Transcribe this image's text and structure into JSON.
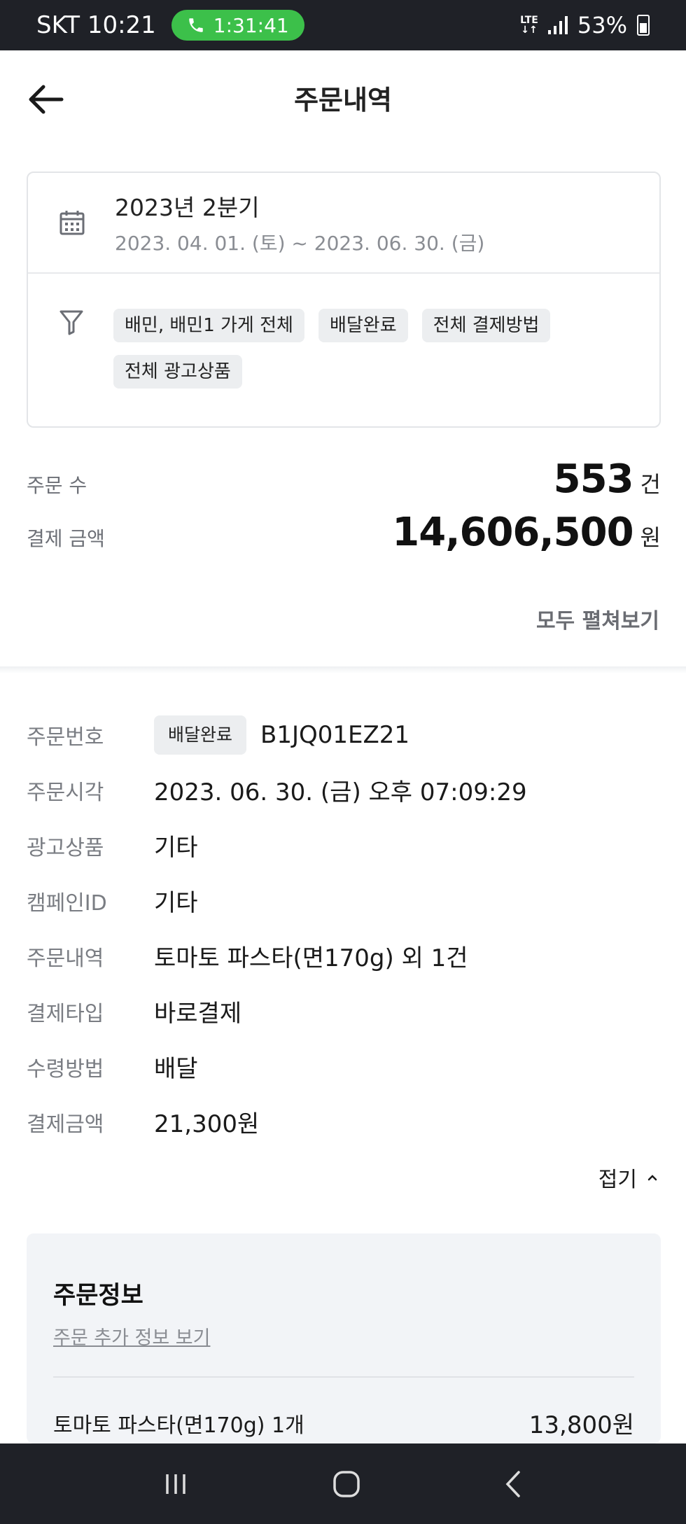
{
  "status_bar": {
    "carrier_time": "SKT 10:21",
    "call_timer": "1:31:41",
    "network": "LTE",
    "battery": "53%"
  },
  "header": {
    "title": "주문내역"
  },
  "period": {
    "title": "2023년 2분기",
    "range": "2023. 04. 01. (토) ~ 2023. 06. 30. (금)"
  },
  "filters": [
    "배민, 배민1 가게 전체",
    "배달완료",
    "전체 결제방법",
    "전체 광고상품"
  ],
  "summary": {
    "order_count_label": "주문 수",
    "order_count": "553",
    "order_count_unit": "건",
    "amount_label": "결제 금액",
    "amount": "14,606,500",
    "amount_unit": "원",
    "expand_all": "모두 펼쳐보기"
  },
  "order": {
    "status_badge": "배달완료",
    "rows": [
      {
        "label": "주문번호",
        "value": "B1JQ01EZ21"
      },
      {
        "label": "주문시각",
        "value": "2023. 06. 30. (금) 오후 07:09:29"
      },
      {
        "label": "광고상품",
        "value": "기타"
      },
      {
        "label": "캠페인ID",
        "value": "기타"
      },
      {
        "label": "주문내역",
        "value": "토마토 파스타(면170g) 외 1건"
      },
      {
        "label": "결제타입",
        "value": "바로결제"
      },
      {
        "label": "수령방법",
        "value": "배달"
      },
      {
        "label": "결제금액",
        "value": "21,300원"
      }
    ],
    "collapse": "접기"
  },
  "order_info": {
    "title": "주문정보",
    "more_link": "주문 추가 정보 보기",
    "items": [
      {
        "name": "토마토 파스타(면170g) 1개",
        "price": "13,800원"
      }
    ]
  },
  "icons": {
    "back": "arrow-left-icon",
    "calendar": "calendar-icon",
    "filter": "filter-icon",
    "chevron_up": "chevron-up-icon"
  }
}
